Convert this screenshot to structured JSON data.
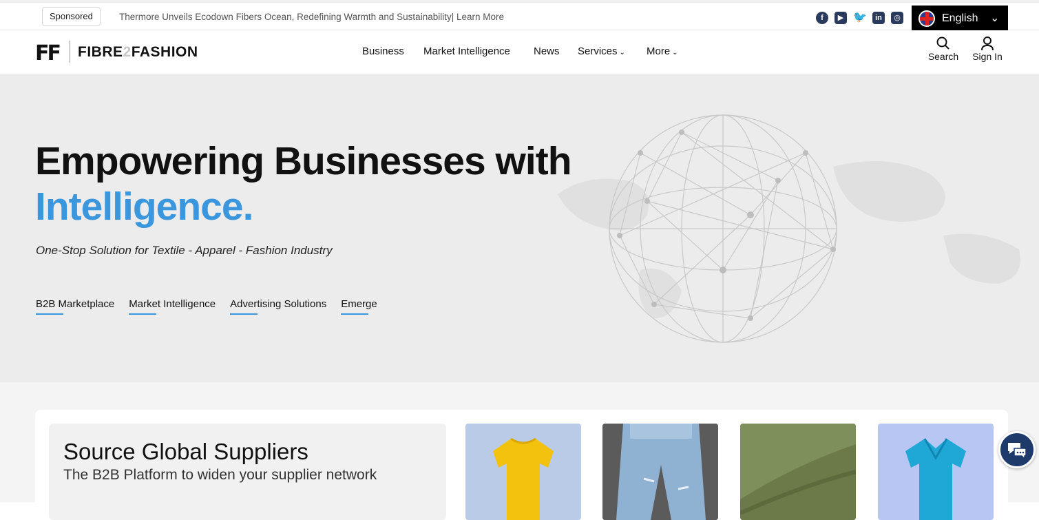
{
  "topbar": {
    "sponsored_label": "Sponsored",
    "sponsored_text": "Thermore Unveils Ecodown Fibers Ocean, Redefining Warmth and Sustainability| Learn More",
    "social": [
      "facebook-icon",
      "youtube-icon",
      "twitter-icon",
      "linkedin-icon",
      "instagram-icon"
    ],
    "language": "English"
  },
  "nav": {
    "logo_mark": "FF",
    "logo_text_1": "FIBRE",
    "logo_text_2": "2",
    "logo_text_3": "FASHION",
    "items": [
      "Business",
      "Market Intelligence",
      "News",
      "Services",
      "More"
    ],
    "search_label": "Search",
    "signin_label": "Sign In"
  },
  "hero": {
    "title_line1": "Empowering Businesses with",
    "title_line2": "Intelligence.",
    "subtitle": "One-Stop Solution for Textile - Apparel - Fashion Industry",
    "links": [
      "B2B Marketplace",
      "Market Intelligence",
      "Advertising Solutions",
      "Emerge"
    ]
  },
  "source": {
    "title": "Source Global Suppliers",
    "subtitle": "The B2B Platform to widen your supplier network"
  },
  "colors": {
    "accent": "#3a97de",
    "hero_bg": "#ececec",
    "lang_bg": "#000000",
    "social": "#2a3a5c",
    "chat": "#1d3a6b"
  }
}
